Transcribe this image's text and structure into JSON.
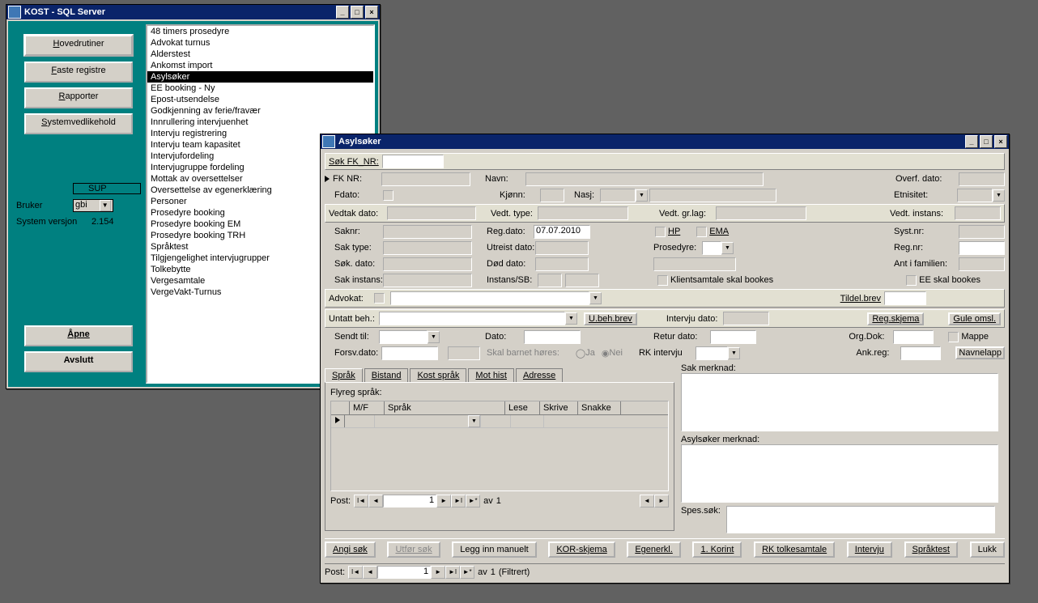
{
  "kost": {
    "title": "KOST  - SQL Server",
    "nav": {
      "hoved": "Hovedrutiner",
      "faste": "Faste registre",
      "rapporter": "Rapporter",
      "system": "Systemvedlikehold"
    },
    "sup": "SUP",
    "bruker_label": "Bruker",
    "bruker": "gbi",
    "versjon_label": "System versjon",
    "versjon": "2.154",
    "apne": "Åpne",
    "avslutt": "Avslutt",
    "list": [
      "48 timers prosedyre",
      "Advokat turnus",
      "Alderstest",
      "Ankomst import",
      "Asylsøker",
      "EE booking - Ny",
      "Epost-utsendelse",
      "Godkjenning av ferie/fravær",
      "Innrullering intervjuenhet",
      "Intervju registrering",
      "Intervju team kapasitet",
      "Intervjufordeling",
      "Intervjugruppe fordeling",
      "Mottak av oversettelser",
      "Oversettelse av egenerklæring",
      "Personer",
      "Prosedyre booking",
      "Prosedyre booking EM",
      "Prosedyre booking TRH",
      "Språktest",
      "Tilgjengelighet intervjugrupper",
      "Tolkebytte",
      "Vergesamtale",
      "VergeVakt-Turnus"
    ],
    "selected": 4
  },
  "asy": {
    "title": "Asylsøker",
    "sok_fk": "Søk FK_NR:",
    "labels": {
      "fknr": "FK NR:",
      "navn": "Navn:",
      "overf": "Overf. dato:",
      "fdato": "Fdato:",
      "kjonn": "Kjønn:",
      "nasj": "Nasj:",
      "etnisitet": "Etnisitet:",
      "vedtakdato": "Vedtak dato:",
      "vedttype": "Vedt. type:",
      "vedtgrlag": "Vedt. gr.lag:",
      "vedtinstans": "Vedt. instans:",
      "saknr": "Saknr:",
      "regdato": "Reg.dato:",
      "regdato_val": "07.07.2010",
      "hp": "HP",
      "ema": "EMA",
      "systnr": "Syst.nr:",
      "saktype": "Sak type:",
      "utreist": "Utreist dato:",
      "prosedyre": "Prosedyre:",
      "regnr": "Reg.nr:",
      "sokdato": "Søk. dato:",
      "doddato": "Død dato:",
      "antfam": "Ant i familien:",
      "sakinstans": "Sak instans:",
      "instanssb": "Instans/SB:",
      "klientsamtale": "Klientsamtale skal bookes",
      "eeskal": "EE skal bookes",
      "advokat": "Advokat:",
      "tildelbrev": "Tildel.brev",
      "untatt": "Untatt beh.:",
      "ubehbrev": "U.beh.brev",
      "intervjudato": "Intervju dato:",
      "regskjema": "Reg.skjema",
      "guleomsl": "Gule omsl.",
      "sendttil": "Sendt til:",
      "dato": "Dato:",
      "returdato": "Retur dato:",
      "orgdok": "Org.Dok:",
      "mappe": "Mappe",
      "forsvdato": "Forsv.dato:",
      "skalbarnet": "Skal barnet høres:",
      "ja": "Ja",
      "nei": "Nei",
      "rkintervju": "RK intervju",
      "ankreg": "Ank.reg:",
      "navnelapp": "Navnelapp"
    },
    "tabs": [
      "Språk",
      "Bistand",
      "Kost språk",
      "Mot hist",
      "Adresse"
    ],
    "flyreg": "Flyreg språk:",
    "gridcols": {
      "mf": "M/F",
      "sprak": "Språk",
      "lese": "Lese",
      "skrive": "Skrive",
      "snakke": "Snakke"
    },
    "post": "Post:",
    "av": "av",
    "avn": "1",
    "filtrert": "(Filtrert)",
    "sakmerk": "Sak merknad:",
    "asymerk": "Asylsøker merknad:",
    "spessok": "Spes.søk:",
    "buttons": {
      "angisok": "Angi søk",
      "utforsok": "Utfør søk",
      "legginn": "Legg inn manuelt",
      "kor": "KOR-skjema",
      "egen": "Egenerkl.",
      "korint": "1. Korint",
      "rktolk": "RK tolkesamtale",
      "intervju": "Intervju",
      "spraktest": "Språktest",
      "lukk": "Lukk"
    }
  }
}
